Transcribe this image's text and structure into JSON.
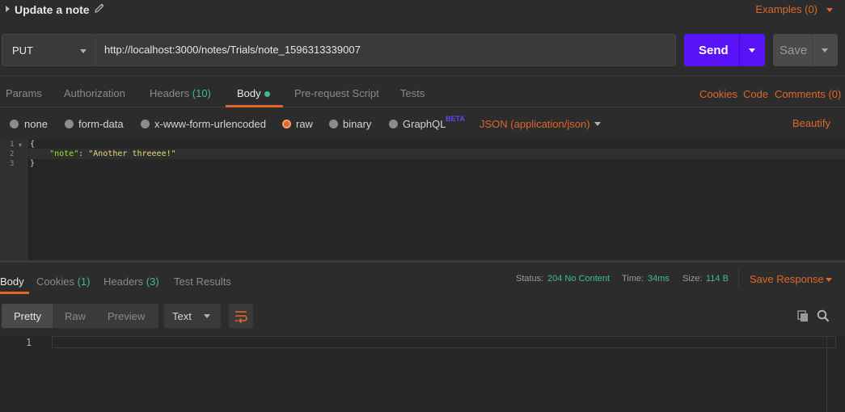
{
  "request": {
    "title": "Update a note",
    "examples_label": "Examples (0)",
    "method": "PUT",
    "url": "http://localhost:3000/notes/Trials/note_1596313339007",
    "send_label": "Send",
    "save_label": "Save"
  },
  "tabs": {
    "params": "Params",
    "authorization": "Authorization",
    "headers": "Headers",
    "headers_count": "(10)",
    "body": "Body",
    "prerequest": "Pre-request Script",
    "tests": "Tests",
    "cookies": "Cookies",
    "code": "Code",
    "comments": "Comments (0)"
  },
  "body_types": {
    "none": "none",
    "form_data": "form-data",
    "urlencoded": "x-www-form-urlencoded",
    "raw": "raw",
    "binary": "binary",
    "graphql": "GraphQL",
    "beta": "BETA",
    "json_type": "JSON (application/json)",
    "selected": "raw",
    "beautify": "Beautify"
  },
  "editor": {
    "line_numbers": [
      "1",
      "2",
      "3"
    ],
    "line1": "{",
    "key": "\"note\"",
    "colon": ": ",
    "value": "\"Another threeee!\"",
    "line3": "}"
  },
  "response": {
    "tabs": {
      "body": "Body",
      "cookies": "Cookies",
      "cookies_count": "(1)",
      "headers": "Headers",
      "headers_count": "(3)",
      "tests": "Test Results"
    },
    "status_label": "Status:",
    "status_value": "204 No Content",
    "time_label": "Time:",
    "time_value": "34ms",
    "size_label": "Size:",
    "size_value": "114 B",
    "save_response": "Save Response",
    "views": {
      "pretty": "Pretty",
      "raw": "Raw",
      "preview": "Preview"
    },
    "format": "Text",
    "line_number": "1"
  },
  "colors": {
    "accent": "#e0672a",
    "send": "#5a13f6",
    "success": "#3fbd8d",
    "background": "#2c2c2c"
  }
}
